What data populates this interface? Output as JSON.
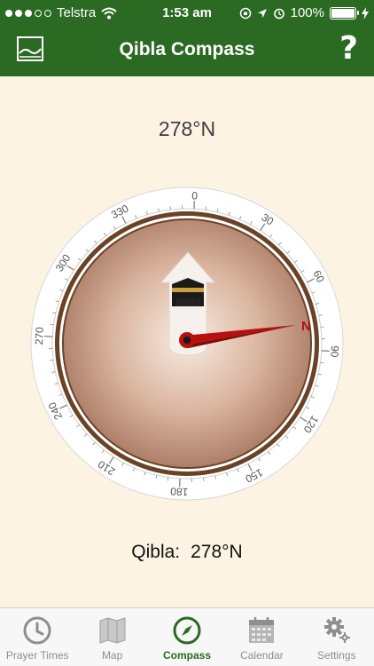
{
  "status_bar": {
    "carrier": "Telstra",
    "time": "1:53 am",
    "battery": "100%"
  },
  "header": {
    "title": "Qibla Compass",
    "help_label": "?"
  },
  "compass": {
    "heading_text": "278°N",
    "north_label": "N",
    "qibla_label": "Qibla:",
    "qibla_value": "278°N",
    "ticks": [
      "0",
      "30",
      "60",
      "90",
      "120",
      "150",
      "180",
      "210",
      "240",
      "270",
      "300",
      "330"
    ]
  },
  "tabs": [
    {
      "label": "Prayer Times",
      "icon": "clock-icon"
    },
    {
      "label": "Map",
      "icon": "map-icon"
    },
    {
      "label": "Compass",
      "icon": "compass-icon"
    },
    {
      "label": "Calendar",
      "icon": "calendar-icon"
    },
    {
      "label": "Settings",
      "icon": "settings-icon"
    }
  ],
  "colors": {
    "brand_green": "#2b6a22",
    "background": "#fcf3e3",
    "needle_red": "#b80f0f"
  }
}
